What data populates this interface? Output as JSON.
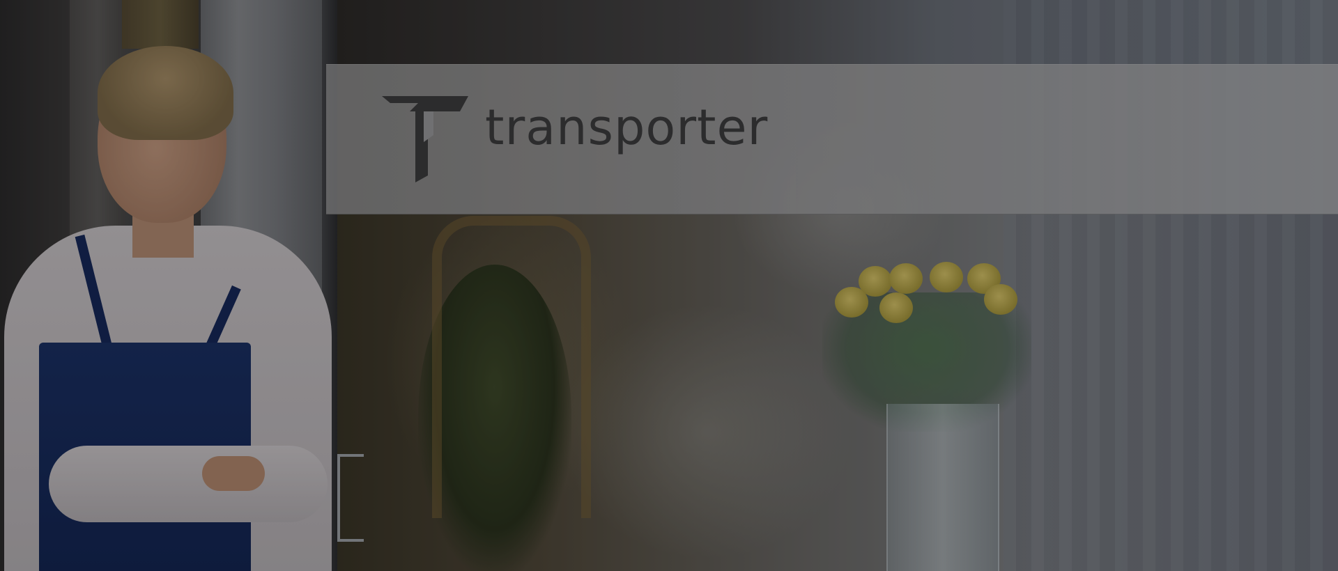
{
  "banner": {
    "brand_text": "transporter",
    "logo_icon": "t-logo-icon"
  },
  "colors": {
    "banner": "#9c9c9e",
    "logo": "#3d3d3f",
    "apron": "#1b3165",
    "roses": "#d9c66a"
  }
}
